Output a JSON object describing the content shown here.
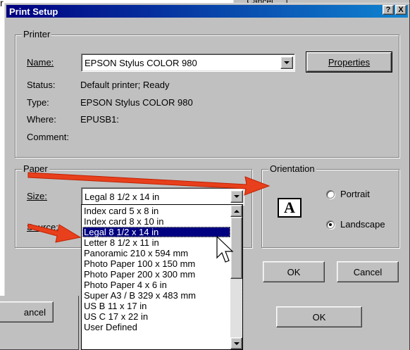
{
  "background": {
    "top_button_label": "Cancel",
    "bottom_left_button_label": "ancel",
    "top_left_fragment": "r"
  },
  "dialog": {
    "title": "Print Setup",
    "help_label": "?",
    "close_label": "X",
    "printer_group": {
      "label": "Printer",
      "name_label": "Name:",
      "name_value": "EPSON Stylus COLOR 980",
      "properties_label": "Properties",
      "status_label": "Status:",
      "status_value": "Default printer; Ready",
      "type_label": "Type:",
      "type_value": "EPSON Stylus COLOR 980",
      "where_label": "Where:",
      "where_value": "EPUSB1:",
      "comment_label": "Comment:"
    },
    "paper_group": {
      "label": "Paper",
      "size_label": "Size:",
      "size_value": "Legal 8 1/2 x 14 in",
      "source_label": "Source:",
      "size_options": [
        "Index card 5 x 8 in",
        "Index card 8 x 10 in",
        "Legal 8 1/2 x 14 in",
        "Letter 8 1/2 x 11 in",
        "Panoramic 210 x 594 mm",
        "Photo Paper 100 x 150 mm",
        "Photo Paper 200 x 300 mm",
        "Photo Paper 4 x 6 in",
        "Super A3 / B 329 x 483 mm",
        "US B 11 x 17 in",
        "US C 17 x 22 in",
        "User Defined"
      ],
      "selected_index": 2
    },
    "orientation_group": {
      "label": "Orientation",
      "icon_letter": "A",
      "portrait_label": "Portrait",
      "landscape_label": "Landscape",
      "selected": "landscape"
    },
    "ok_label": "OK",
    "cancel_label": "Cancel",
    "ok2_label": "OK"
  },
  "colors": {
    "title_bar": "#000080",
    "selection": "#000080",
    "arrow": "#e8401c",
    "face": "#c0c0c0"
  }
}
